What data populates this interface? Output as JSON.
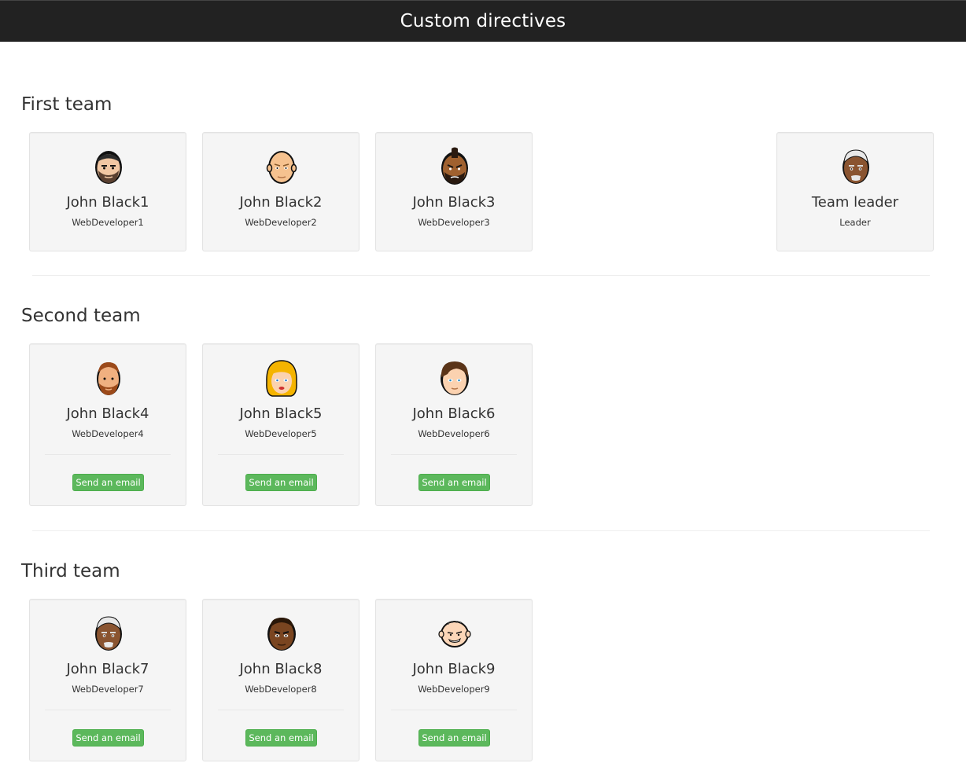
{
  "header": {
    "title": "Custom directives"
  },
  "teams": [
    {
      "title": "First team",
      "members": [
        {
          "name": "John Black1",
          "role": "WebDeveloper1",
          "avatar_icon": "bearded-man-avatar-icon"
        },
        {
          "name": "John Black2",
          "role": "WebDeveloper2",
          "avatar_icon": "bald-man-avatar-icon"
        },
        {
          "name": "John Black3",
          "role": "WebDeveloper3",
          "avatar_icon": "mohawk-man-avatar-icon"
        }
      ],
      "leader": {
        "name": "Team leader",
        "role": "Leader",
        "avatar_icon": "gray-hair-man-avatar-icon"
      }
    },
    {
      "title": "Second team",
      "email_label": "Send an email",
      "members": [
        {
          "name": "John Black4",
          "role": "WebDeveloper4",
          "avatar_icon": "ginger-man-avatar-icon"
        },
        {
          "name": "John Black5",
          "role": "WebDeveloper5",
          "avatar_icon": "blonde-woman-avatar-icon"
        },
        {
          "name": "John Black6",
          "role": "WebDeveloper6",
          "avatar_icon": "brown-hair-man-avatar-icon"
        }
      ]
    },
    {
      "title": "Third team",
      "email_label": "Send an email",
      "members": [
        {
          "name": "John Black7",
          "role": "WebDeveloper7",
          "avatar_icon": "gray-hair-man-avatar-icon"
        },
        {
          "name": "John Black8",
          "role": "WebDeveloper8",
          "avatar_icon": "dark-skin-man-avatar-icon"
        },
        {
          "name": "John Black9",
          "role": "WebDeveloper9",
          "avatar_icon": "grinning-bald-man-avatar-icon"
        }
      ]
    }
  ],
  "colors": {
    "navbar": "#222222",
    "card_background": "#f5f5f5",
    "email_button": "#5cb85c"
  }
}
